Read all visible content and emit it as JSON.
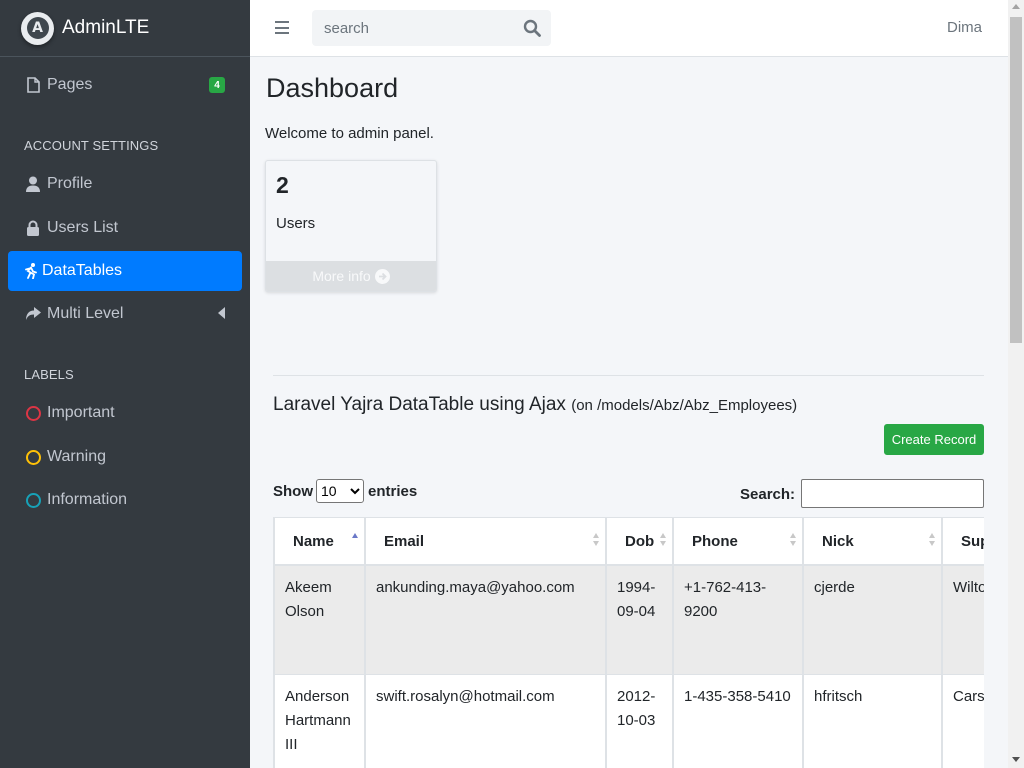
{
  "brand": {
    "name_bold": "Admin",
    "name_light": "LTE",
    "logo_letter": "A"
  },
  "sidebar": {
    "items": [
      {
        "label": "Pages",
        "icon": "file-icon",
        "badge": "4"
      },
      {
        "label": "Profile",
        "icon": "user-icon"
      },
      {
        "label": "Users List",
        "icon": "lock-icon"
      },
      {
        "label": "DataTables",
        "icon": "running-icon",
        "active": true
      },
      {
        "label": "Multi Level",
        "icon": "share-icon"
      }
    ],
    "headers": {
      "account": "ACCOUNT SETTINGS",
      "labels": "LABELS"
    },
    "labels": [
      {
        "label": "Important",
        "color": "#dc3545"
      },
      {
        "label": "Warning",
        "color": "#ffc107"
      },
      {
        "label": "Information",
        "color": "#17a2b8"
      }
    ]
  },
  "navbar": {
    "search_placeholder": "search",
    "user": "Dima"
  },
  "content": {
    "title": "Dashboard",
    "welcome": "Welcome to admin panel.",
    "stat_box": {
      "value": "2",
      "label": "Users",
      "footer": "More info"
    },
    "datatable": {
      "title": "Laravel Yajra DataTable using Ajax",
      "subtitle": "(on /models/Abz/Abz_Employees)",
      "create_button": "Create Record",
      "show_label": "Show",
      "entries_value": "10",
      "entries_label": "entries",
      "search_label": "Search:",
      "columns": [
        "Name",
        "Email",
        "Dob",
        "Phone",
        "Nick",
        "Sup"
      ],
      "rows": [
        {
          "name": "Akeem Olson",
          "email": "ankunding.maya@yahoo.com",
          "dob": "1994-09-04",
          "phone": "+1-762-413-9200",
          "nick": "cjerde",
          "sup": "Wilto"
        },
        {
          "name": "Anderson Hartmann III",
          "email": "swift.rosalyn@hotmail.com",
          "dob": "2012-10-03",
          "phone": "1-435-358-5410",
          "nick": "hfritsch",
          "sup": "Carso Adan"
        }
      ]
    }
  },
  "colors": {
    "sidebar_bg": "#343a40",
    "active": "#007bff",
    "success": "#28a745"
  }
}
